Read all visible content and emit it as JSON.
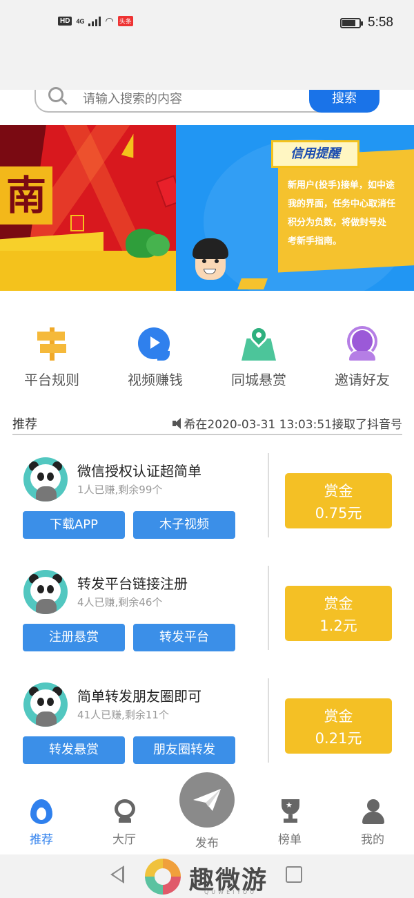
{
  "status_bar": {
    "hd": "HD",
    "network": "4G",
    "app_badge": "头条",
    "time": "5:58"
  },
  "search": {
    "placeholder": "请输入搜索的内容",
    "button_label": "搜索"
  },
  "banner": {
    "left_glyph": "南",
    "notice_tag": "信用提醒",
    "notice_text": "新用户(投手)接单，如中途\n我的界面，任务中心取消任\n积分为负数，将做封号处\n考新手指南。"
  },
  "categories": [
    {
      "label": "平台规则",
      "icon": "signpost-icon"
    },
    {
      "label": "视频赚钱",
      "icon": "video-play-icon"
    },
    {
      "label": "同城悬赏",
      "icon": "location-pin-icon"
    },
    {
      "label": "邀请好友",
      "icon": "headset-icon"
    }
  ],
  "recommend": {
    "title": "推荐",
    "news": "希在2020-03-31 13:03:51接取了抖音号"
  },
  "tasks": [
    {
      "title": "微信授权认证超简单",
      "sub": "1人已赚,剩余99个",
      "tag_a": "下载APP",
      "tag_b": "木子视频",
      "reward_label": "赏金",
      "reward_value": "0.75元"
    },
    {
      "title": "转发平台链接注册",
      "sub": "4人已赚,剩余46个",
      "tag_a": "注册悬赏",
      "tag_b": "转发平台",
      "reward_label": "赏金",
      "reward_value": "1.2元"
    },
    {
      "title": "简单转发朋友圈即可",
      "sub": "41人已赚,剩余11个",
      "tag_a": "转发悬赏",
      "tag_b": "朋友圈转发",
      "reward_label": "赏金",
      "reward_value": "0.21元"
    }
  ],
  "bottom_nav": {
    "items": [
      {
        "label": "推荐",
        "active": true
      },
      {
        "label": "大厅",
        "active": false
      },
      {
        "label": "榜单",
        "active": false
      },
      {
        "label": "我的",
        "active": false
      }
    ],
    "publish_label": "发布"
  },
  "watermark": {
    "text": "趣微游",
    "sub": "QUWEIYOU"
  },
  "colors": {
    "accent_blue": "#2f80ed",
    "reward_yellow": "#f4c025",
    "tag_blue": "#3b8fe8"
  }
}
